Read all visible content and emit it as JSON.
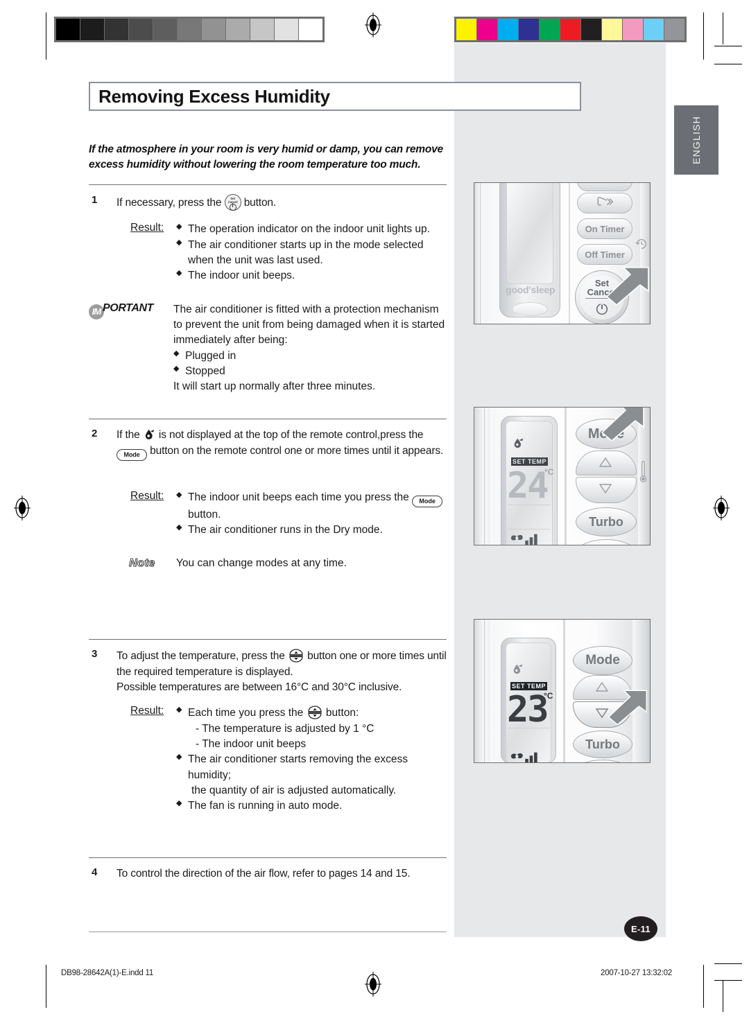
{
  "document": {
    "title": "Removing Excess Humidity",
    "language_tab": "ENGLISH",
    "page_badge": "E-11",
    "intro_line1": "If the atmosphere in your room is very humid or damp, you can remove",
    "intro_line2": "excess humidity without lowering the room temperature too much."
  },
  "steps": {
    "step1": {
      "number": "1",
      "text_before_icon": "If necessary, press the",
      "icon": "set-cancel-button-icon",
      "text_after_icon": "button.",
      "result_label": "Result:",
      "results": [
        "The operation indicator on the indoor unit lights up.",
        "The air conditioner starts up in the mode selected",
        "when the unit was last used.",
        "The indoor unit beeps."
      ]
    },
    "important": {
      "badge_circle": "IM",
      "badge_word": "PORTANT",
      "lines": [
        "The air conditioner is fitted with a protection mechanism",
        "to prevent the unit from being damaged when it is started",
        "immediately after being:",
        "Plugged in",
        "Stopped",
        "It will start up normally after three minutes."
      ]
    },
    "step2": {
      "number": "2",
      "line1_a": "If the",
      "line1_icon": "dry-mode-icon",
      "line1_b": "is not displayed at the top of the remote control,press the",
      "line2_icon": "mode-button-icon",
      "line2_b": "button on the remote control one or more times until it appears.",
      "result_label": "Result:",
      "result1_a": "The indoor unit beeps each time you press the",
      "result1_icon": "mode-button-icon",
      "result1_b": "button.",
      "result2": "The air conditioner runs in the Dry mode.",
      "note_label": "Note",
      "note_text": "You can change modes at any time."
    },
    "step3": {
      "number": "3",
      "line1_a": "To adjust the temperature, press the",
      "line1_icon": "temp-updown-button-icon",
      "line1_b": "button one or more times until",
      "line2": "the required temperature is displayed.",
      "line3": "Possible temperatures are between 16°C and 30°C inclusive.",
      "result_label": "Result:",
      "result1_a": "Each time you press the",
      "result1_icon": "temp-updown-button-icon",
      "result1_b": "button:",
      "sub1": "- The temperature is adjusted by 1 °C",
      "sub2": "- The indoor unit beeps",
      "result2_line1": "The air conditioner starts removing the excess humidity;",
      "result2_line2": "the quantity of air is adjusted automatically.",
      "result3": "The fan is running in auto mode."
    },
    "step4": {
      "number": "4",
      "text": "To control the direction of the air flow, refer to pages 14 and 15."
    }
  },
  "illustrations": {
    "remote1": {
      "name": "remote-control-set-cancel",
      "brand_text": "good'sleep",
      "buttons": [
        "On Timer",
        "Off Timer"
      ],
      "set_label": "Set",
      "cancel_label": "Cancel",
      "swing_icon": "air-swing-icon",
      "timer_icon": "timer-clock-icon",
      "power_icon": "power-icon",
      "cursor": "arrow-cursor-pointing-at-set-cancel"
    },
    "remote2": {
      "name": "remote-control-mode",
      "display_temp": "24",
      "display_unit": "°C",
      "display_label": "SET TEMP",
      "dry_icon": "dry-mode-icon",
      "buttons": [
        "Mode",
        "Turbo"
      ],
      "up_icon": "triangle-up-icon",
      "down_icon": "triangle-down-icon",
      "fan_icon": "fan-icon",
      "thermometer_icon": "thermometer-icon",
      "fan_speed_icon": "fan-speed-bars-icon",
      "cursor": "arrow-cursor-pointing-at-mode"
    },
    "remote3": {
      "name": "remote-control-temp-down",
      "display_temp": "23",
      "display_unit": "°C",
      "display_label": "SET TEMP",
      "dry_icon": "dry-mode-icon",
      "buttons": [
        "Mode",
        "Turbo"
      ],
      "up_icon": "triangle-up-icon",
      "down_icon": "triangle-down-icon",
      "fan_icon": "fan-icon",
      "fan_speed_icon": "fan-speed-bars-icon",
      "cursor": "arrow-cursor-pointing-at-temp-down"
    }
  },
  "footer": {
    "file_name": "DB98-28642A(1)-E.indd   11",
    "timestamp": "2007-10-27   13:32:02"
  },
  "prepress": {
    "grayscale_patches": [
      "#000000",
      "#1c1c1c",
      "#333333",
      "#4c4c4c",
      "#5e5e5e",
      "#787878",
      "#929292",
      "#ababab",
      "#c6c6c6",
      "#e2e2e2",
      "#ffffff"
    ],
    "color_patches": [
      "#fff200",
      "#ec008c",
      "#00aeef",
      "#2e3192",
      "#00a651",
      "#ed1c24",
      "#231f20",
      "#fff79a",
      "#f49ac1",
      "#6dcff6",
      "#939598"
    ],
    "registration_mark": "registration-target-icon"
  },
  "colors": {
    "shade_column": "#e6e8ea",
    "tab_background": "#6b6e74",
    "title_border": "#8c8fa3",
    "badge_background": "#231f20"
  }
}
